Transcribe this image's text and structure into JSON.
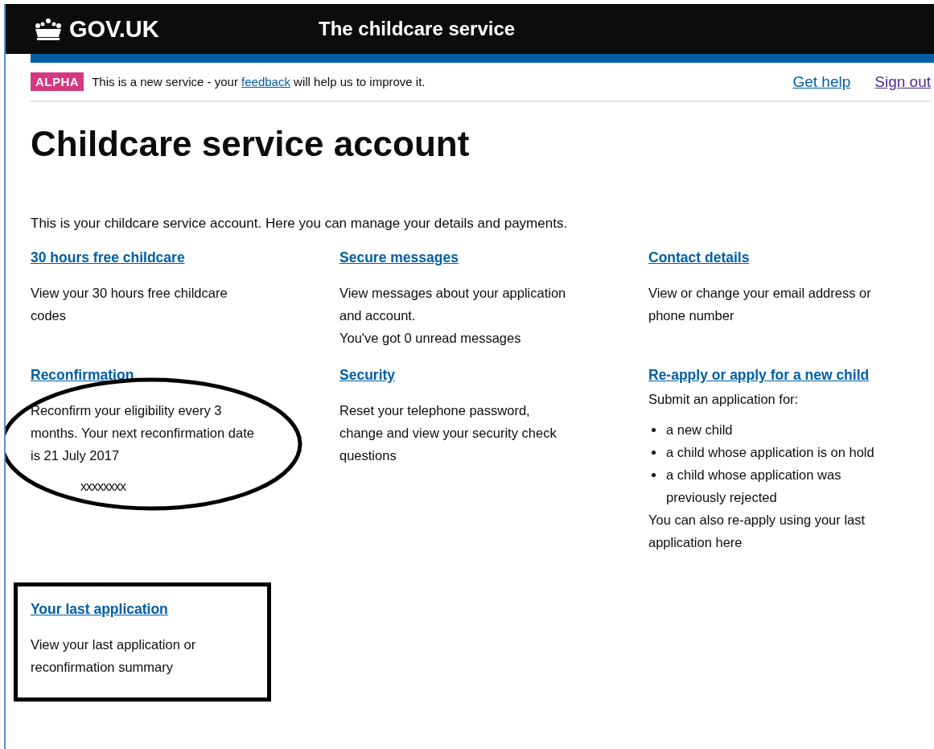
{
  "header": {
    "logo": "GOV.UK",
    "service_name": "The childcare service"
  },
  "phase_banner": {
    "tag": "ALPHA",
    "message_before": "This is a new service - your",
    "link": "feedback",
    "message_after": "will help us to improve it.",
    "links": [
      {
        "label": "Get help",
        "visited": false
      },
      {
        "label": "Sign out",
        "visited": true
      }
    ]
  },
  "title": "Childcare service account",
  "intro": "This is your childcare service account. Here you can manage your details and payments.",
  "cards": [
    {
      "title": "30 hours free childcare",
      "body": [
        {
          "kind": "text",
          "text": "View your 30 hours free childcare codes"
        }
      ]
    },
    {
      "title": "Secure messages",
      "body": [
        {
          "kind": "text",
          "text": "View messages about your application and account."
        },
        {
          "kind": "note",
          "text": "You've got 0 unread messages"
        }
      ]
    },
    {
      "title": "Contact details",
      "body": [
        {
          "kind": "text",
          "text": "View or change your email address or phone number"
        }
      ]
    },
    {
      "title": "Reconfirmation",
      "circled": true,
      "body": [
        {
          "kind": "text",
          "text": "Reconfirm your eligibility every 3 months. Your next reconfirmation date is 21 July 2017",
          "overwrite": "xxxxxxxx"
        }
      ]
    },
    {
      "title": "Security",
      "body": [
        {
          "kind": "text",
          "text": "Reset your telephone password, change and view your security check questions"
        }
      ]
    },
    {
      "title": "Re-apply or apply for a new child",
      "body": [
        {
          "kind": "lead",
          "text": "Submit an application for:"
        },
        {
          "kind": "list",
          "items": [
            "a new child",
            "a child whose application is on hold",
            "a child whose application was previously rejected"
          ]
        },
        {
          "kind": "note",
          "text": "You can also re-apply using your last application here"
        }
      ]
    },
    {
      "title": "Your last application",
      "boxed": true,
      "body": [
        {
          "kind": "text",
          "text": "View your last application or reconfirmation summary"
        }
      ]
    }
  ]
}
